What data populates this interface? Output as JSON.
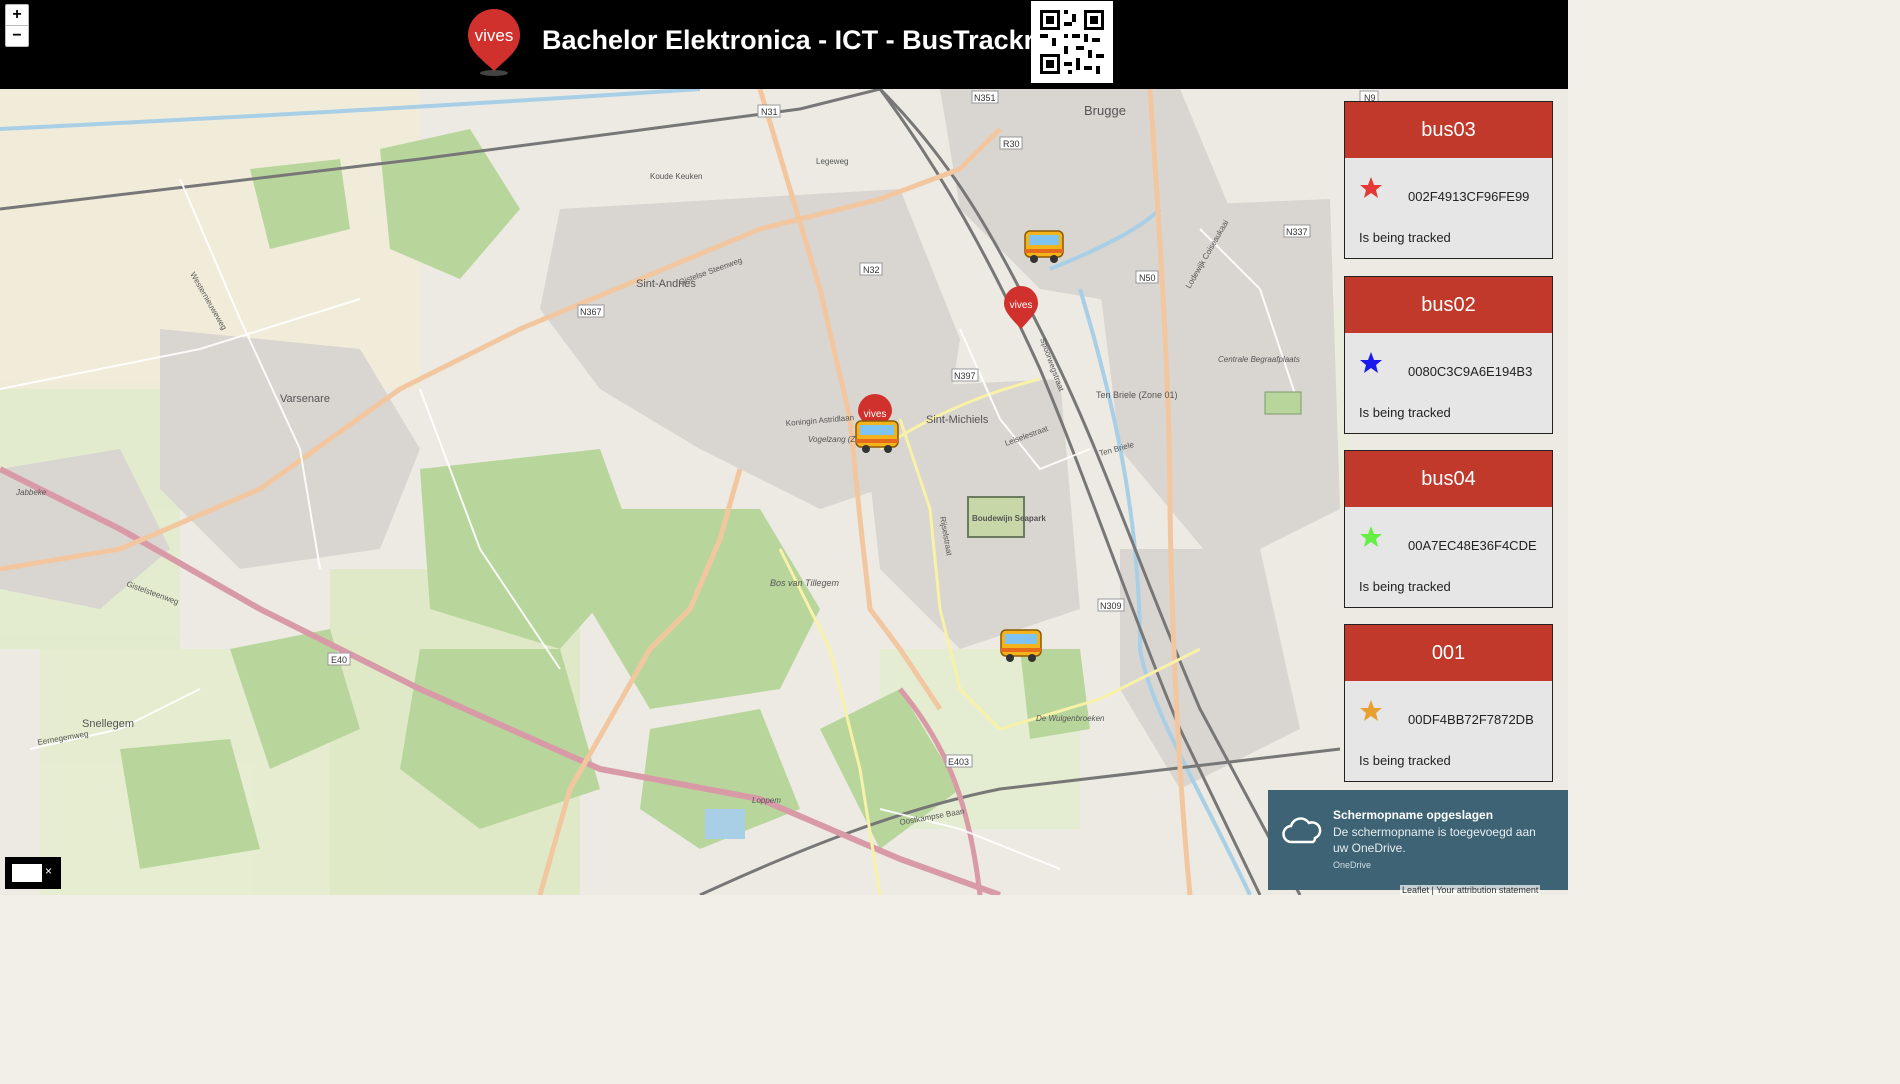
{
  "header": {
    "logo_text": "vives",
    "title": "Bachelor Elektronica - ICT - BusTrackr"
  },
  "zoom": {
    "in_label": "+",
    "out_label": "−"
  },
  "map": {
    "places": [
      "Brugge",
      "Sint-Andries",
      "Varsenare",
      "Sint-Michiels",
      "Snellegem",
      "Koude Keuken",
      "Bos van Tillegem",
      "Boudewijn Seapark",
      "Vogelzang (Zone 02)",
      "Ten Briele (Zone 01)",
      "Centrale Begraafplaats",
      "De Wulgenbroeken",
      "Loppem",
      "Jabbeke"
    ],
    "streets": [
      "Legeweg",
      "Gistelse Steenweg",
      "Koningin Astridlaan",
      "Leiselestraat",
      "Ten Briele",
      "Rijselstraat",
      "Oostkampse Baan",
      "Eernegemweg",
      "Gistelsteenweg",
      "Westernieuweweg",
      "Spoorwegstraat",
      "Lodewijk Coiseaukaai"
    ],
    "road_refs": [
      "N31",
      "N32",
      "N367",
      "N397",
      "R30",
      "N50",
      "E40",
      "E403",
      "N309",
      "N351",
      "N9",
      "N337"
    ]
  },
  "buses": [
    {
      "name": "bus03",
      "dev_id": "002F4913CF96FE99",
      "status": "Is being tracked",
      "color": "#e53935"
    },
    {
      "name": "bus02",
      "dev_id": "0080C3C9A6E194B3",
      "status": "Is being tracked",
      "color": "#1a1aee"
    },
    {
      "name": "bus04",
      "dev_id": "00A7EC48E36F4CDE",
      "status": "Is being tracked",
      "color": "#66ee44"
    },
    {
      "name": "001",
      "dev_id": "00DF4BB72F7872DB",
      "status": "Is being tracked",
      "color": "#e8a030"
    }
  ],
  "markers": {
    "pin_text": "vives"
  },
  "notification": {
    "title": "Schermopname opgeslagen",
    "message": "De schermopname is toegevoegd aan uw OneDrive.",
    "source": "OneDrive"
  },
  "layer_control": {
    "close_label": "×"
  },
  "attribution": "Leaflet | Your attribution statement"
}
